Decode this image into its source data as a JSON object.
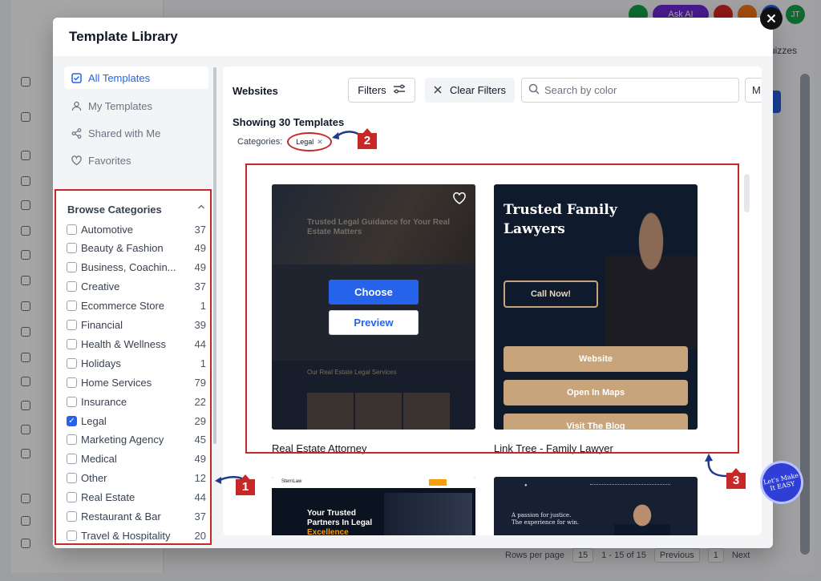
{
  "modal": {
    "title": "Template Library",
    "close_symbol": "×"
  },
  "nav": {
    "items": [
      {
        "label": "All Templates",
        "icon": "checkbox-square-icon",
        "active": true
      },
      {
        "label": "My Templates",
        "icon": "user-icon",
        "active": false
      },
      {
        "label": "Shared with Me",
        "icon": "share-icon",
        "active": false
      },
      {
        "label": "Favorites",
        "icon": "heart-icon",
        "active": false
      }
    ]
  },
  "categories": {
    "heading": "Browse Categories",
    "items": [
      {
        "name": "Automotive",
        "count": "37",
        "checked": false
      },
      {
        "name": "Beauty & Fashion",
        "count": "49",
        "checked": false
      },
      {
        "name": "Business, Coachin...",
        "count": "49",
        "checked": false
      },
      {
        "name": "Creative",
        "count": "37",
        "checked": false
      },
      {
        "name": "Ecommerce Store",
        "count": "1",
        "checked": false
      },
      {
        "name": "Financial",
        "count": "39",
        "checked": false
      },
      {
        "name": "Health & Wellness",
        "count": "44",
        "checked": false
      },
      {
        "name": "Holidays",
        "count": "1",
        "checked": false
      },
      {
        "name": "Home Services",
        "count": "79",
        "checked": false
      },
      {
        "name": "Insurance",
        "count": "22",
        "checked": false
      },
      {
        "name": "Legal",
        "count": "29",
        "checked": true
      },
      {
        "name": "Marketing Agency",
        "count": "45",
        "checked": false
      },
      {
        "name": "Medical",
        "count": "49",
        "checked": false
      },
      {
        "name": "Other",
        "count": "12",
        "checked": false
      },
      {
        "name": "Real Estate",
        "count": "44",
        "checked": false
      },
      {
        "name": "Restaurant & Bar",
        "count": "37",
        "checked": false
      },
      {
        "name": "Travel & Hospitality",
        "count": "20",
        "checked": false
      }
    ]
  },
  "toolbar": {
    "section_title": "Websites",
    "filters_label": "Filters",
    "clear_filters_label": "Clear Filters",
    "search_placeholder": "Search by color",
    "more_label": "M"
  },
  "results": {
    "showing": "Showing 30 Templates",
    "categories_label": "Categories:",
    "active_chip": "Legal"
  },
  "cards": [
    {
      "name": "Real Estate Attorney",
      "choose_label": "Choose",
      "preview_label": "Preview",
      "hero_text": "Trusted Legal Guidance for Your Real Estate Matters",
      "section_text": "Our Real Estate Legal Services"
    },
    {
      "name": "Link Tree - Family Lawyer",
      "title": "Trusted Family Lawyers",
      "call_label": "Call Now!",
      "buttons": [
        "Website",
        "Open In Maps",
        "Visit The Blog"
      ]
    },
    {
      "brand": "SternLaw",
      "hero_text_1": "Your Trusted",
      "hero_text_2": "Partners In Legal",
      "hero_text_3": "Excellence"
    },
    {
      "tagline_1": "A passion for justice.",
      "tagline_2": "The experience for win."
    }
  ],
  "annotations": {
    "badge_1": "1",
    "badge_2": "2",
    "badge_3": "3",
    "watermark": "Let's Make It EASY"
  },
  "background": {
    "pill": "Ask AI",
    "avatar_initials": "JT",
    "quizzes": "uizzes",
    "rows_per_page": "Rows per page",
    "rows_value": "15",
    "range": "1 - 15 of 15",
    "previous": "Previous",
    "page": "1",
    "next": "Next"
  },
  "colors": {
    "accent": "#2563eb",
    "annotation_red": "#c62828",
    "template_gold": "#c8a47a"
  }
}
